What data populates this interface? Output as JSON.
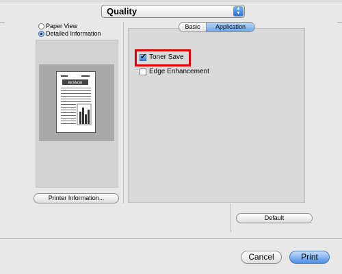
{
  "dropdown": {
    "value": "Quality"
  },
  "view_options": [
    {
      "label": "Paper View",
      "selected": false
    },
    {
      "label": "Detailed Information",
      "selected": true
    }
  ],
  "preview": {
    "heading_text": "RKSNOR"
  },
  "printer_info_button": "Printer Information...",
  "tabs": {
    "basic": "Basic",
    "application": "Application",
    "active": "Application"
  },
  "options": {
    "toner_save": {
      "label": "Toner Save",
      "checked": true
    },
    "edge_enhancement": {
      "label": "Edge Enhancement",
      "checked": false
    }
  },
  "default_button": "Default",
  "cancel_button": "Cancel",
  "print_button": "Print",
  "colors": {
    "highlight": "#e00000",
    "accent": "#3a7fd8"
  }
}
